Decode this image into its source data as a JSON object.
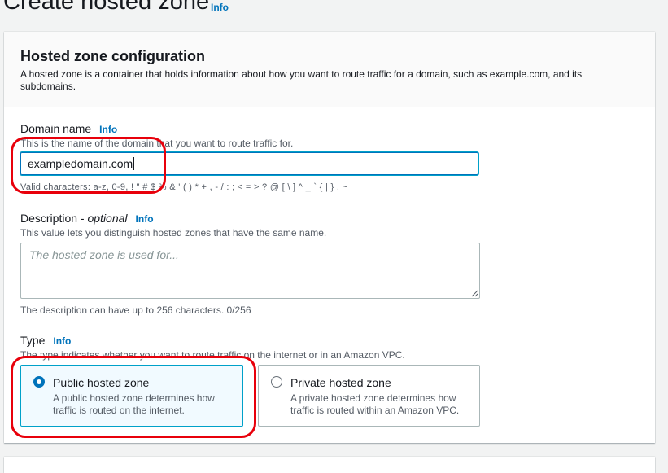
{
  "page": {
    "title": "Create hosted zone",
    "info": "Info"
  },
  "config": {
    "title": "Hosted zone configuration",
    "description": "A hosted zone is a container that holds information about how you want to route traffic for a domain, such as example.com, and its subdomains."
  },
  "domain": {
    "label": "Domain name",
    "info": "Info",
    "description": "This is the name of the domain that you want to route traffic for.",
    "value": "exampledomain.com",
    "constraint": "Valid characters: a-z, 0-9, ! \" # $ % & ' ( ) * + , - / : ; < = > ? @ [ \\ ] ^ _ ` { | } . ~"
  },
  "description_field": {
    "label": "Description -",
    "optional": "optional",
    "info": "Info",
    "description": "This value lets you distinguish hosted zones that have the same name.",
    "placeholder": "The hosted zone is used for...",
    "constraint": "The description can have up to 256 characters. 0/256"
  },
  "type": {
    "label": "Type",
    "info": "Info",
    "description": "The type indicates whether you want to route traffic on the internet or in an Amazon VPC.",
    "options": [
      {
        "title": "Public hosted zone",
        "description": "A public hosted zone determines how traffic is routed on the internet.",
        "selected": true
      },
      {
        "title": "Private hosted zone",
        "description": "A private hosted zone determines how traffic is routed within an Amazon VPC.",
        "selected": false
      }
    ]
  },
  "colors": {
    "accent": "#0073bb",
    "highlight": "#e8000b",
    "selected_tile_bg": "#f1faff"
  }
}
